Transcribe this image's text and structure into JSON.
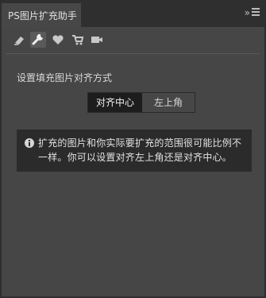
{
  "panel": {
    "title": "PS图片扩充助手",
    "collapse_symbol": "»",
    "menu_icon": "hamburger-menu-icon"
  },
  "toolbar": {
    "tools": [
      {
        "icon": "eraser-icon",
        "active": false
      },
      {
        "icon": "wrench-icon",
        "active": true
      },
      {
        "icon": "heart-icon",
        "active": false
      },
      {
        "icon": "cart-icon",
        "active": false
      },
      {
        "icon": "video-camera-icon",
        "active": false
      }
    ]
  },
  "settings": {
    "fill_alignment_label": "设置填充图片对齐方式",
    "options": [
      "对齐中心",
      "左上角"
    ],
    "selected": "对齐中心"
  },
  "info": {
    "icon": "info-icon",
    "text": "扩充的图片和你实际要扩充的范围很可能比例不一样。你可以设置对齐左上角还是对齐中心。"
  },
  "colors": {
    "panel_bg": "#464646",
    "titlebar_bg": "#2f2f2f",
    "selected_bg": "#1d1d1d",
    "info_bg": "#2b2b2b"
  }
}
